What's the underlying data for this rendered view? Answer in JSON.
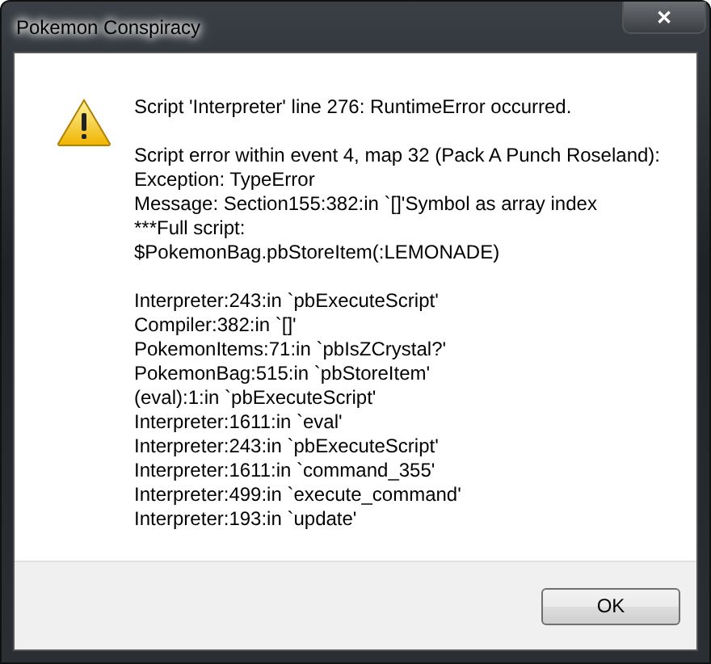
{
  "window": {
    "title": "Pokemon Conspiracy",
    "close_button": "✕"
  },
  "message": {
    "paragraphs": [
      [
        "Script 'Interpreter' line 276: RuntimeError occurred."
      ],
      [
        "Script error within event 4, map 32 (Pack A Punch Roseland):",
        "Exception: TypeError",
        "Message: Section155:382:in `[]'Symbol as array index",
        "***Full script:",
        "$PokemonBag.pbStoreItem(:LEMONADE)"
      ],
      [
        "Interpreter:243:in `pbExecuteScript'",
        "Compiler:382:in `[]'",
        "PokemonItems:71:in `pbIsZCrystal?'",
        "PokemonBag:515:in `pbStoreItem'",
        "(eval):1:in `pbExecuteScript'",
        "Interpreter:1611:in `eval'",
        "Interpreter:243:in `pbExecuteScript'",
        "Interpreter:1611:in `command_355'",
        "Interpreter:499:in `execute_command'",
        "Interpreter:193:in `update'"
      ]
    ]
  },
  "buttons": [
    "OK"
  ]
}
